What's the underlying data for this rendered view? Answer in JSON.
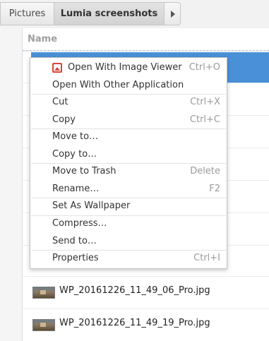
{
  "breadcrumb": {
    "items": [
      {
        "label": "Pictures"
      },
      {
        "label": "Lumia screenshots"
      }
    ],
    "next_icon": "chevron-right-icon"
  },
  "list": {
    "column_header": "Name",
    "files": [
      {
        "name": "WP_20161226_11_49_06_Pro.jpg",
        "icon": "image-thumbnail"
      },
      {
        "name": "WP_20161226_11_49_19_Pro.jpg",
        "icon": "image-thumbnail"
      }
    ]
  },
  "context_menu": {
    "items": [
      {
        "label": "Open With Image Viewer",
        "accel": "Ctrl+O",
        "icon": "image-viewer-icon"
      },
      {
        "label": "Open With Other Application",
        "accel": ""
      },
      {
        "label": "Cut",
        "accel": "Ctrl+X"
      },
      {
        "label": "Copy",
        "accel": "Ctrl+C"
      },
      {
        "label": "Move to…",
        "accel": ""
      },
      {
        "label": "Copy to…",
        "accel": ""
      },
      {
        "label": "Move to Trash",
        "accel": "Delete"
      },
      {
        "label": "Rename…",
        "accel": "F2"
      },
      {
        "label": "Set As Wallpaper",
        "accel": ""
      },
      {
        "label": "Compress…",
        "accel": ""
      },
      {
        "label": "Send to…",
        "accel": ""
      },
      {
        "label": "Properties",
        "accel": "Ctrl+I"
      }
    ]
  },
  "colors": {
    "selection": "#4a90d9",
    "menu_background": "#ffffff",
    "accelerator_text": "#9a9a9a"
  }
}
